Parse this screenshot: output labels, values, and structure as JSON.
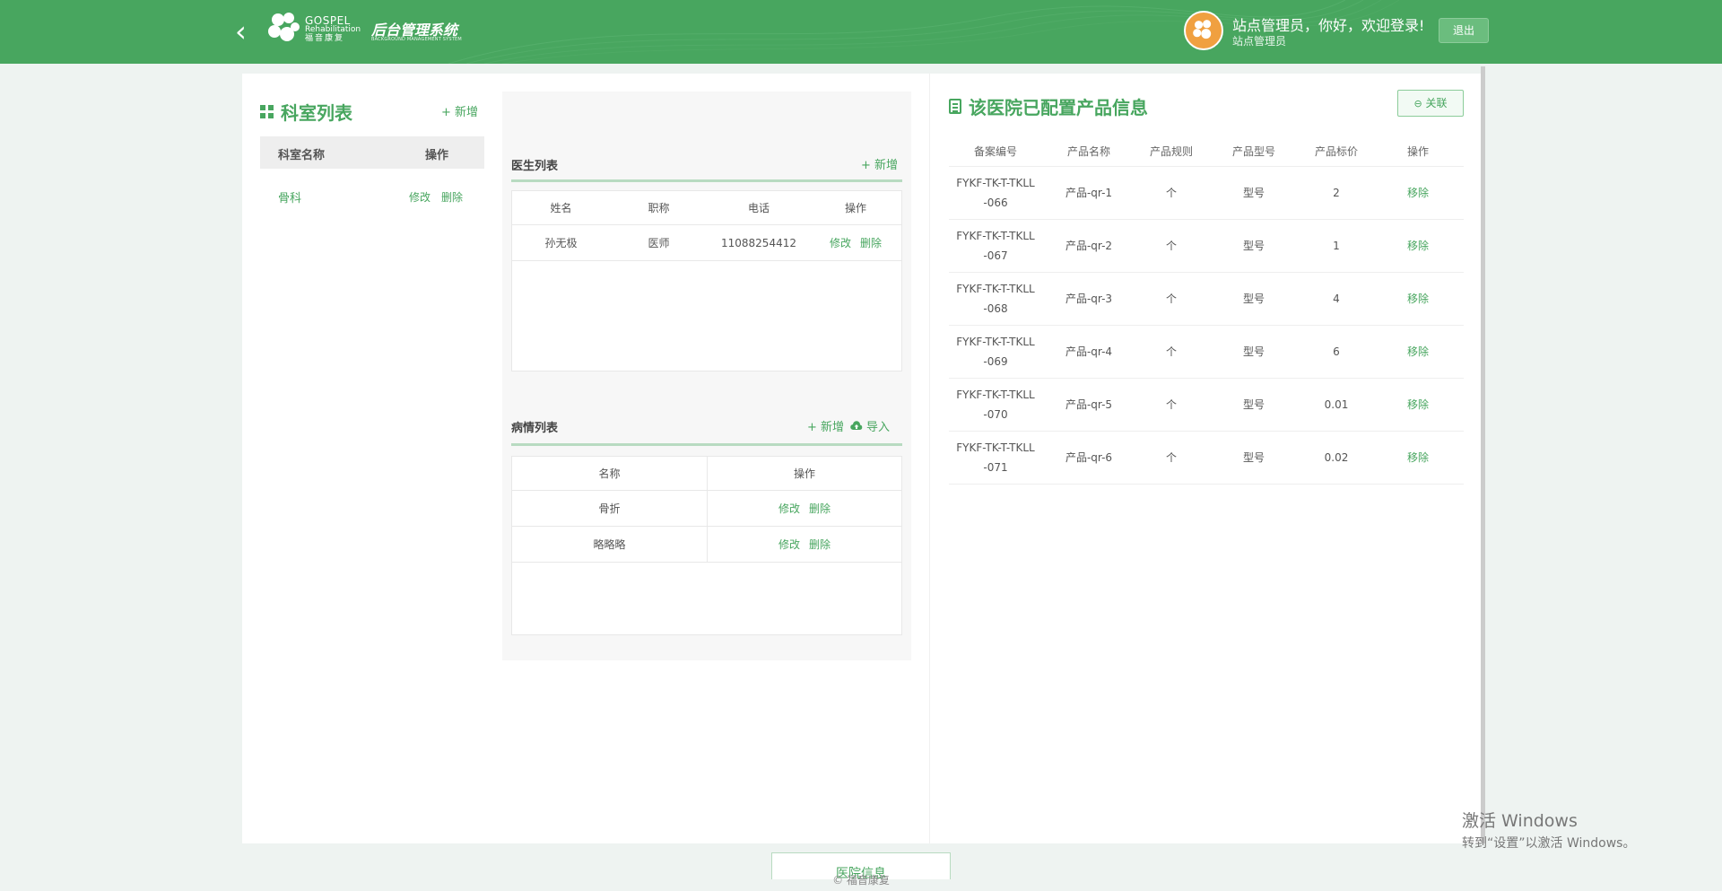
{
  "header": {
    "logo_line1": "GOSPEL",
    "logo_line2": "Rehabilitation",
    "logo_line3": "福音康复",
    "system_title": "后台管理系统",
    "system_subtitle": "BACKGROUND MANAGEMENT SYSTEM",
    "welcome": "站点管理员，你好，欢迎登录!",
    "role": "站点管理员",
    "logout": "退出"
  },
  "dept": {
    "title": "科室列表",
    "add": "+ 新增",
    "col_name": "科室名称",
    "col_op": "操作",
    "rows": [
      {
        "name": "骨科",
        "edit": "修改",
        "delete": "删除"
      }
    ]
  },
  "doctors": {
    "title": "医生列表",
    "add": "+ 新增",
    "cols": [
      "姓名",
      "职称",
      "电话",
      "操作"
    ],
    "rows": [
      {
        "name": "孙无极",
        "title": "医师",
        "phone": "11088254412",
        "edit": "修改",
        "delete": "删除"
      }
    ]
  },
  "conditions": {
    "title": "病情列表",
    "add": "+ 新增",
    "import": "导入",
    "cols": [
      "名称",
      "操作"
    ],
    "rows": [
      {
        "name": "骨折",
        "edit": "修改",
        "delete": "删除"
      },
      {
        "name": "略略略",
        "edit": "修改",
        "delete": "删除"
      }
    ]
  },
  "products": {
    "title": "该医院已配置产品信息",
    "link": "关联",
    "cols": [
      "备案编号",
      "产品名称",
      "产品规则",
      "产品型号",
      "产品标价",
      "操作"
    ],
    "rows": [
      {
        "code1": "FYKF-TK-T-TKLL",
        "code2": "-066",
        "name": "产品-qr-1",
        "rule": "个",
        "model": "型号",
        "price": "2",
        "op": "移除"
      },
      {
        "code1": "FYKF-TK-T-TKLL",
        "code2": "-067",
        "name": "产品-qr-2",
        "rule": "个",
        "model": "型号",
        "price": "1",
        "op": "移除"
      },
      {
        "code1": "FYKF-TK-T-TKLL",
        "code2": "-068",
        "name": "产品-qr-3",
        "rule": "个",
        "model": "型号",
        "price": "4",
        "op": "移除"
      },
      {
        "code1": "FYKF-TK-T-TKLL",
        "code2": "-069",
        "name": "产品-qr-4",
        "rule": "个",
        "model": "型号",
        "price": "6",
        "op": "移除"
      },
      {
        "code1": "FYKF-TK-T-TKLL",
        "code2": "-070",
        "name": "产品-qr-5",
        "rule": "个",
        "model": "型号",
        "price": "0.01",
        "op": "移除"
      },
      {
        "code1": "FYKF-TK-T-TKLL",
        "code2": "-071",
        "name": "产品-qr-6",
        "rule": "个",
        "model": "型号",
        "price": "0.02",
        "op": "移除"
      }
    ]
  },
  "footer": {
    "tab": "医院信息",
    "copyright": "© 福音康复"
  },
  "watermark": {
    "line1": "激活 Windows",
    "line2": "转到“设置”以激活 Windows。"
  },
  "colors": {
    "brand": "#48a65f"
  }
}
